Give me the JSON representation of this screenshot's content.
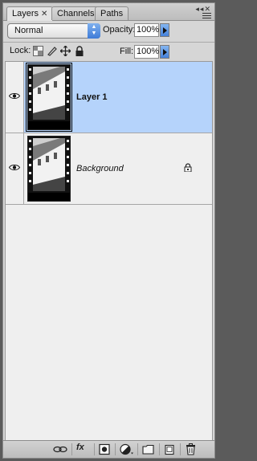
{
  "tabs": [
    {
      "label": "Layers",
      "close": "✕"
    },
    {
      "label": "Channels"
    },
    {
      "label": "Paths"
    }
  ],
  "blend_mode": "Normal",
  "opacity": {
    "label": "Opacity:",
    "value": "100%"
  },
  "lock": {
    "label": "Lock:"
  },
  "fill": {
    "label": "Fill:",
    "value": "100%"
  },
  "layers": [
    {
      "name": "Layer 1",
      "selected": true,
      "visible": true
    },
    {
      "name": "Background",
      "selected": false,
      "visible": true,
      "locked": true
    }
  ],
  "footer": {
    "fx_label": "fx"
  },
  "colors": {
    "selection": "#b5d3fb",
    "accent": "#3e7bd7"
  }
}
